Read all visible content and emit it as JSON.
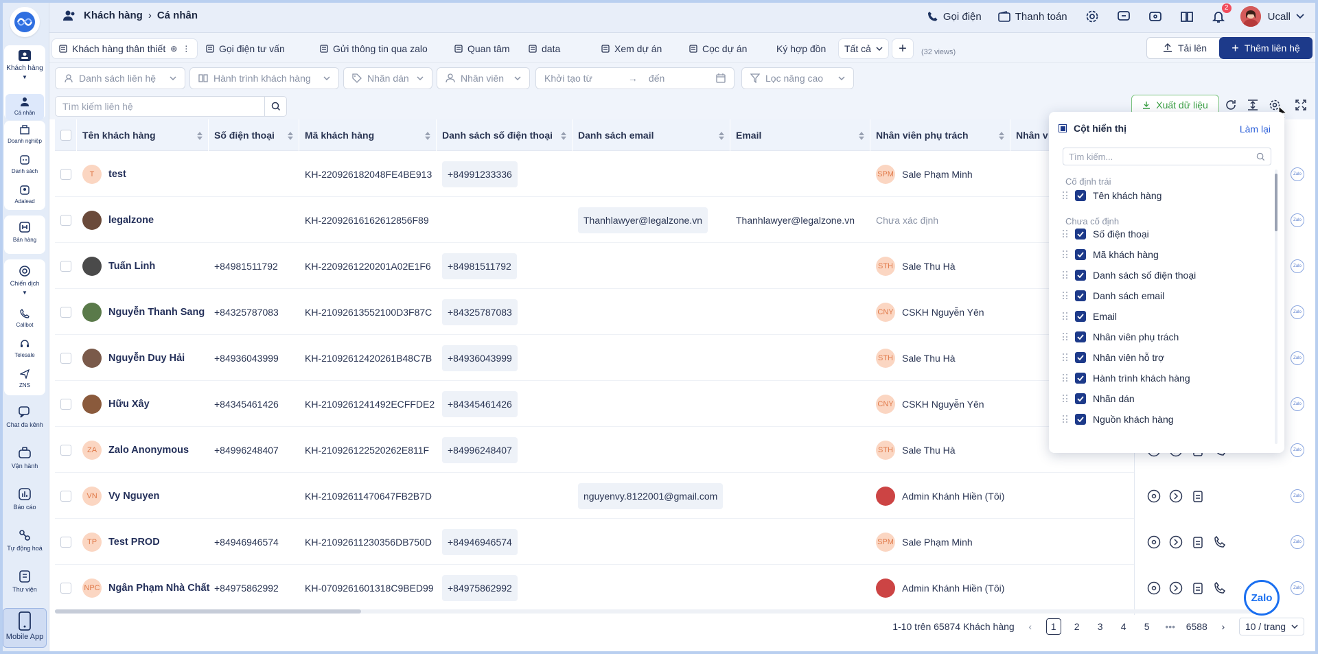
{
  "sidebar": {
    "items": [
      {
        "label": "Khách hàng",
        "icon": "contacts-icon"
      },
      {
        "label": "Cá nhân",
        "icon": "person-icon"
      },
      {
        "label": "Doanh nghiệp",
        "icon": "business-icon"
      },
      {
        "label": "Danh sách",
        "icon": "list-icon"
      },
      {
        "label": "Adalead",
        "icon": "adalead-icon"
      },
      {
        "label": "Bản hàng",
        "icon": "shop-icon"
      },
      {
        "label": "Chiến dịch",
        "icon": "campaign-icon"
      },
      {
        "label": "Callbot",
        "icon": "phone-icon"
      },
      {
        "label": "Telesale",
        "icon": "headset-icon"
      },
      {
        "label": "ZNS",
        "icon": "send-icon"
      },
      {
        "label": "Chat đa kênh",
        "icon": "chat-icon"
      },
      {
        "label": "Vận hành",
        "icon": "briefcase-icon"
      },
      {
        "label": "Báo cáo",
        "icon": "report-icon"
      },
      {
        "label": "Tự động hoá",
        "icon": "automation-icon"
      },
      {
        "label": "Thư viện",
        "icon": "library-icon"
      },
      {
        "label": "Mobile App",
        "icon": "mobile-icon"
      }
    ]
  },
  "header": {
    "crumb_root": "Khách hàng",
    "crumb_leaf": "Cá nhân",
    "call_label": "Gọi điện",
    "pay_label": "Thanh toán",
    "notif_count": "2",
    "user_name": "Ucall"
  },
  "tabs": {
    "items": [
      "Khách hàng thân thiết",
      "Gọi điện tư vấn",
      "Gửi thông tin qua zalo",
      "Quan tâm",
      "data",
      "Xem dự án",
      "Cọc dự án",
      "Ký hợp đồn"
    ],
    "all_label": "Tất cả",
    "views_label": "(32 views)",
    "upload_label": "Tải lên",
    "add_contact_label": "Thêm liên hệ"
  },
  "filters": {
    "contact_list": "Danh sách liên hệ",
    "journey": "Hành trình khách hàng",
    "tag": "Nhãn dán",
    "staff": "Nhân viên",
    "created_from": "Khởi tạo từ",
    "created_to": "đến",
    "advanced": "Lọc nâng cao"
  },
  "search": {
    "placeholder": "Tìm kiếm liên hệ"
  },
  "toolbar": {
    "export_label": "Xuất dữ liệu"
  },
  "table": {
    "columns": [
      "Tên khách hàng",
      "Số điện thoại",
      "Mã khách hàng",
      "Danh sách số điện thoại",
      "Danh sách email",
      "Email",
      "Nhân viên phụ trách",
      "Nhân v"
    ],
    "rows": [
      {
        "initials": "T",
        "name": "test",
        "phone": "",
        "code": "KH-220926182048FE4BE913",
        "phones": "+84991233336",
        "emails": "",
        "email": "",
        "staff_init": "SPM",
        "staff": "Sale Phạm Minh"
      },
      {
        "initials": "",
        "name": "legalzone",
        "phone": "",
        "code": "KH-22092616162612856F89",
        "phones": "",
        "emails": "Thanhlawyer@legalzone.vn",
        "email": "Thanhlawyer@legalzone.vn",
        "staff_init": "",
        "staff": "Chưa xác định"
      },
      {
        "initials": "",
        "name": "Tuấn Linh",
        "phone": "+84981511792",
        "code": "KH-2209261220201A02E1F6",
        "phones": "+84981511792",
        "emails": "",
        "email": "",
        "staff_init": "STH",
        "staff": "Sale Thu Hà"
      },
      {
        "initials": "",
        "name": "Nguyễn Thanh Sang",
        "phone": "+84325787083",
        "code": "KH-21092613552100D3F87C",
        "phones": "+84325787083",
        "emails": "",
        "email": "",
        "staff_init": "CNY",
        "staff": "CSKH Nguyễn Yên"
      },
      {
        "initials": "",
        "name": "Nguyễn Duy Hải",
        "phone": "+84936043999",
        "code": "KH-21092612420261B48C7B",
        "phones": "+84936043999",
        "emails": "",
        "email": "",
        "staff_init": "STH",
        "staff": "Sale Thu Hà"
      },
      {
        "initials": "",
        "name": "Hữu Xây",
        "phone": "+84345461426",
        "code": "KH-2109261241492ECFFDE2",
        "phones": "+84345461426",
        "emails": "",
        "email": "",
        "staff_init": "CNY",
        "staff": "CSKH Nguyễn Yên"
      },
      {
        "initials": "ZA",
        "name": "Zalo Anonymous",
        "phone": "+84996248407",
        "code": "KH-210926122520262E811F",
        "phones": "+84996248407",
        "emails": "",
        "email": "",
        "staff_init": "STH",
        "staff": "Sale Thu Hà"
      },
      {
        "initials": "VN",
        "name": "Vy Nguyen",
        "phone": "",
        "code": "KH-21092611470647FB2B7D",
        "phones": "",
        "emails": "nguyenvy.8122001@gmail.com",
        "email": "",
        "staff_init": "",
        "staff": "Admin Khánh Hiền (Tôi)"
      },
      {
        "initials": "TP",
        "name": "Test PROD",
        "phone": "+84946946574",
        "code": "KH-21092611230356DB750D",
        "phones": "+84946946574",
        "emails": "",
        "email": "",
        "staff_init": "SPM",
        "staff": "Sale Phạm Minh"
      },
      {
        "initials": "NPC",
        "name": "Ngân Phạm Nhà Chất",
        "phone": "+84975862992",
        "code": "KH-0709261601318C9BED99",
        "phones": "+84975862992",
        "emails": "",
        "email": "",
        "staff_init": "",
        "staff": "Admin Khánh Hiền (Tôi)"
      }
    ]
  },
  "pagination": {
    "summary": "1-10 trên 65874 Khách hàng",
    "pages": [
      "1",
      "2",
      "3",
      "4",
      "5"
    ],
    "ellipsis": "•••",
    "last": "6588",
    "page_size": "10 / trang"
  },
  "column_panel": {
    "title": "Cột hiển thị",
    "reset_label": "Làm lại",
    "search_placeholder": "Tìm kiếm...",
    "group_fixed": "Cố định trái",
    "group_unfixed": "Chưa cố định",
    "fixed_items": [
      "Tên khách hàng"
    ],
    "items": [
      "Số điện thoại",
      "Mã khách hàng",
      "Danh sách số điện thoại",
      "Danh sách email",
      "Email",
      "Nhân viên phụ trách",
      "Nhân viên hỗ trợ",
      "Hành trình khách hàng",
      "Nhãn dán",
      "Nguồn khách hàng"
    ]
  },
  "fab_label": "Zalo",
  "colors": {
    "primary": "#1d3a8a",
    "accent_green": "#4caf50",
    "link": "#2b5fd9",
    "badge": "#f14c5c"
  }
}
